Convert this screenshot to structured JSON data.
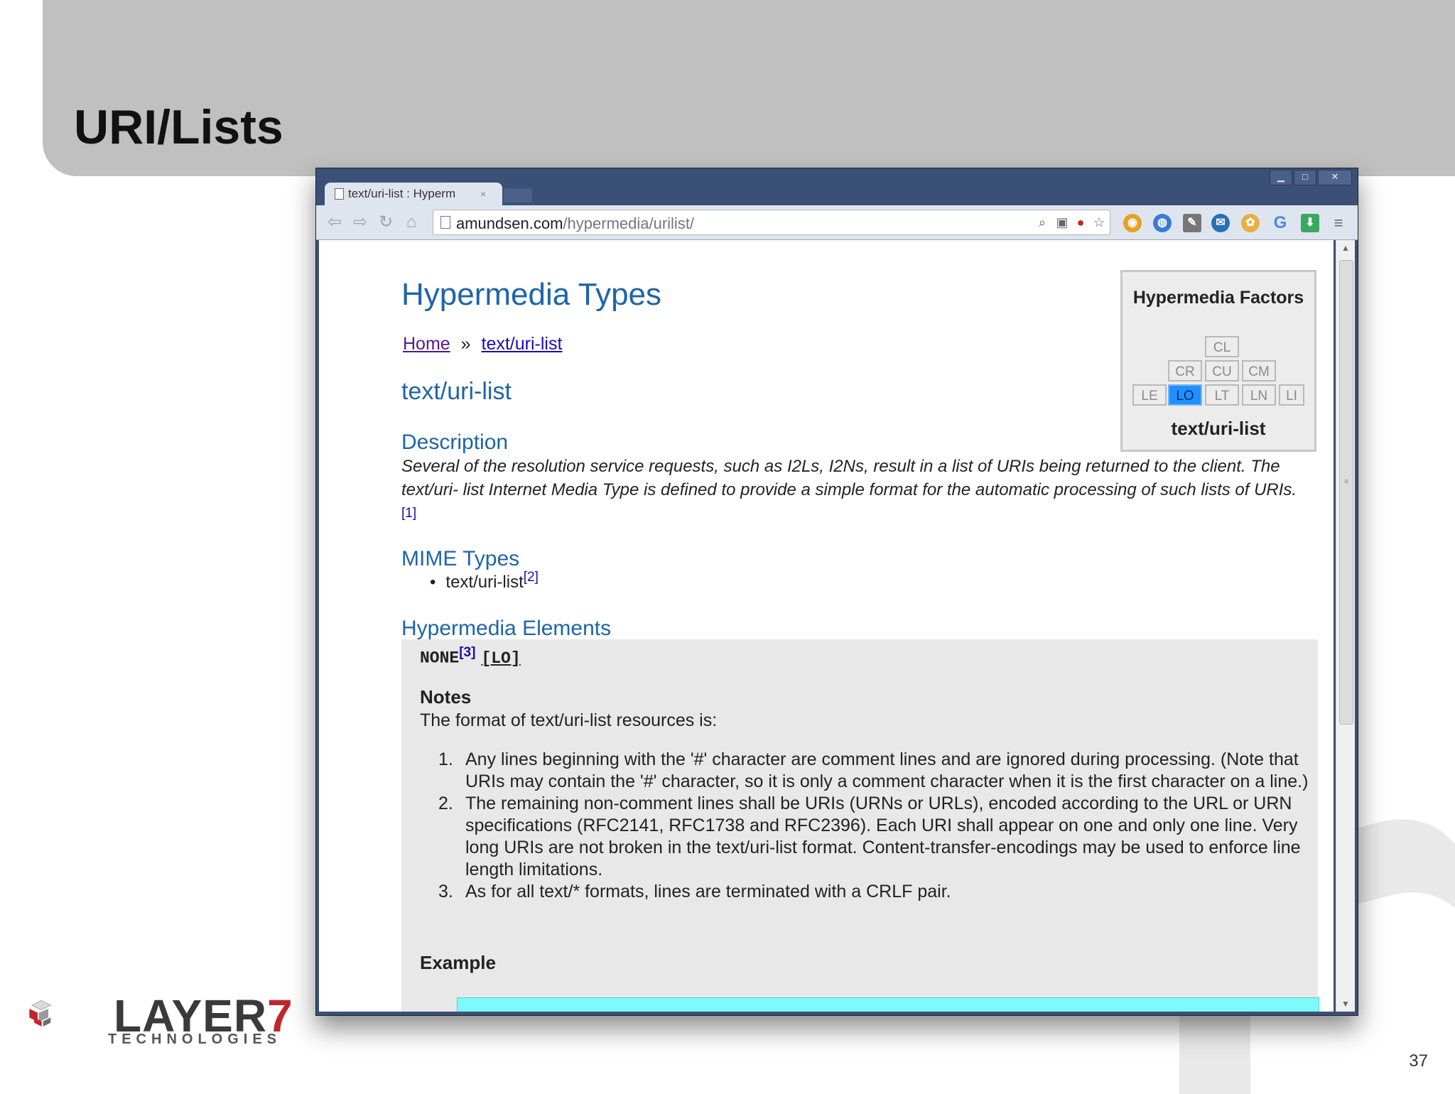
{
  "slide": {
    "title": "URI/Lists",
    "page_number": "37",
    "logo": {
      "word": "LAYER",
      "seven": "7",
      "sub": "TECHNOLOGIES"
    }
  },
  "browser": {
    "tab_title": "text/uri-list : Hyperm",
    "tab_close": "×",
    "url_host": "amundsen.com",
    "url_path": "/hypermedia/urilist/",
    "window_controls": [
      "▁",
      "□",
      "✕"
    ]
  },
  "page": {
    "heading": "Hypermedia Types",
    "breadcrumb": {
      "home": "Home",
      "separator": "»",
      "current": "text/uri-list"
    },
    "type_title": "text/uri-list",
    "description_heading": "Description",
    "description_text": "Several of the resolution service requests, such as I2Ls, I2Ns, result in a list of URIs being returned to the client. The text/uri- list Internet Media Type is defined to provide a simple format for the automatic processing of such lists of URIs.",
    "description_ref": "[1]",
    "mime_heading": "MIME Types",
    "mime_item": "text/uri-list",
    "mime_ref": "[2]",
    "elements_heading": "Hypermedia Elements",
    "elements_value": "NONE",
    "elements_ref": "[3]",
    "elements_factor": "[LO]",
    "notes_heading": "Notes",
    "notes_intro": "The format of text/uri-list resources is:",
    "notes_items": [
      {
        "num": "1.",
        "text": "Any lines beginning with the '#' character are comment lines and are ignored during processing. (Note that URIs may contain the '#' character, so it is only a comment character when it is the first character on a line.)"
      },
      {
        "num": "2.",
        "text": "The remaining non-comment lines shall be URIs (URNs or URLs), encoded according to the URL or URN specifications (RFC2141, RFC1738 and RFC2396). Each URI shall appear on one and only one line. Very long URIs are not broken in the text/uri-list format. Content-transfer-encodings may be used to enforce line length limitations."
      },
      {
        "num": "3.",
        "text": "As for all text/* formats, lines are terminated with a CRLF pair."
      }
    ],
    "example_heading": "Example"
  },
  "factors": {
    "title": "Hypermedia Factors",
    "type": "text/uri-list",
    "cells": {
      "CL": "CL",
      "CR": "CR",
      "CU": "CU",
      "CM": "CM",
      "LE": "LE",
      "LO": "LO",
      "LT": "LT",
      "LN": "LN",
      "LI": "LI"
    },
    "active": "LO",
    "active_color": "#1e90ff"
  },
  "colors": {
    "heading_blue": "#1e64a8",
    "code_bg": "#7ffafb",
    "frame": "#3a5077"
  }
}
